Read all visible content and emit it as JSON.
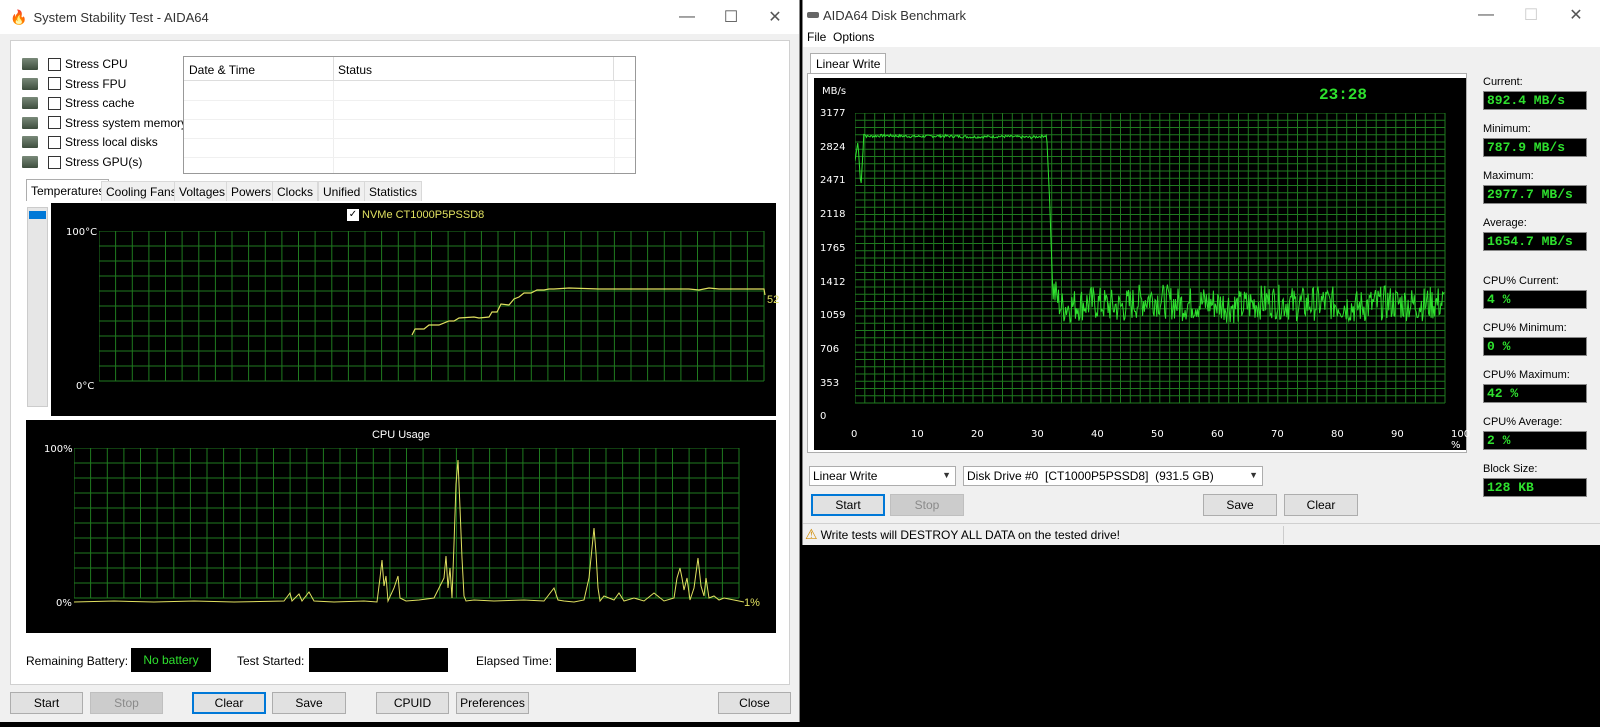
{
  "sst": {
    "title": "System Stability Test - AIDA64",
    "stress": [
      {
        "label": "Stress CPU",
        "icon": "cpu-icon"
      },
      {
        "label": "Stress FPU",
        "icon": "fpu-icon"
      },
      {
        "label": "Stress cache",
        "icon": "cache-icon"
      },
      {
        "label": "Stress system memory",
        "icon": "memory-icon"
      },
      {
        "label": "Stress local disks",
        "icon": "disk-icon"
      },
      {
        "label": "Stress GPU(s)",
        "icon": "gpu-icon"
      }
    ],
    "log_headers": [
      "Date & Time",
      "Status"
    ],
    "tabs": [
      "Temperatures",
      "Cooling Fans",
      "Voltages",
      "Powers",
      "Clocks",
      "Unified",
      "Statistics"
    ],
    "temp_chart": {
      "legend": "NVMe CT1000P5PSSD8",
      "y_top": "100°C",
      "y_bottom": "0°C",
      "current": "52"
    },
    "cpu_chart": {
      "title": "CPU Usage",
      "y_top": "100%",
      "y_bottom": "0%",
      "current": "1%"
    },
    "battery_label": "Remaining Battery:",
    "battery_value": "No battery",
    "test_started_label": "Test Started:",
    "elapsed_label": "Elapsed Time:",
    "buttons": {
      "start": "Start",
      "stop": "Stop",
      "clear": "Clear",
      "save": "Save",
      "cpuid": "CPUID",
      "preferences": "Preferences",
      "close": "Close"
    }
  },
  "db": {
    "title": "AIDA64 Disk Benchmark",
    "menu": [
      "File",
      "Options"
    ],
    "tab": "Linear Write",
    "chart": {
      "unit": "MB/s",
      "time": "23:28",
      "y_ticks": [
        "3177",
        "2824",
        "2471",
        "2118",
        "1765",
        "1412",
        "1059",
        "706",
        "353",
        "0"
      ],
      "x_ticks": [
        "0",
        "10",
        "20",
        "30",
        "40",
        "50",
        "60",
        "70",
        "80",
        "90",
        "100 %"
      ]
    },
    "chart_data": {
      "type": "line",
      "xlabel": "",
      "ylabel": "MB/s",
      "xlim": [
        0,
        100
      ],
      "ylim": [
        0,
        3177
      ],
      "series": [
        {
          "x": [
            0,
            0.5,
            1,
            1.5,
            2,
            5,
            10,
            15,
            20,
            25,
            30,
            32.5,
            33,
            33.5,
            35,
            40,
            45,
            50,
            55,
            60,
            65,
            70,
            75,
            80,
            85,
            90,
            95,
            100
          ],
          "y": [
            2650,
            2870,
            2350,
            2950,
            2920,
            2930,
            2920,
            2925,
            2915,
            2920,
            2910,
            2930,
            2200,
            1250,
            1050,
            1100,
            1050,
            1150,
            1080,
            1100,
            1050,
            1120,
            1080,
            1100,
            1050,
            1100,
            1080,
            1100
          ]
        }
      ]
    },
    "stats": [
      {
        "label": "Current:",
        "value": "892.4 MB/s"
      },
      {
        "label": "Minimum:",
        "value": "787.9 MB/s"
      },
      {
        "label": "Maximum:",
        "value": "2977.7 MB/s"
      },
      {
        "label": "Average:",
        "value": "1654.7 MB/s"
      },
      {
        "label": "CPU% Current:",
        "value": "4 %"
      },
      {
        "label": "CPU% Minimum:",
        "value": "0 %"
      },
      {
        "label": "CPU% Maximum:",
        "value": "42 %"
      },
      {
        "label": "CPU% Average:",
        "value": "2 %"
      },
      {
        "label": "Block Size:",
        "value": "128 KB"
      }
    ],
    "test_select": "Linear Write",
    "drive_select": "Disk Drive #0  [CT1000P5PSSD8]  (931.5 GB)",
    "buttons": {
      "start": "Start",
      "stop": "Stop",
      "save": "Save",
      "clear": "Clear"
    },
    "warning": "Write tests will DESTROY ALL DATA on the tested drive!"
  },
  "colors": {
    "accent": "#0078d7",
    "green": "#2ee02e",
    "yellow": "#e0e060"
  }
}
